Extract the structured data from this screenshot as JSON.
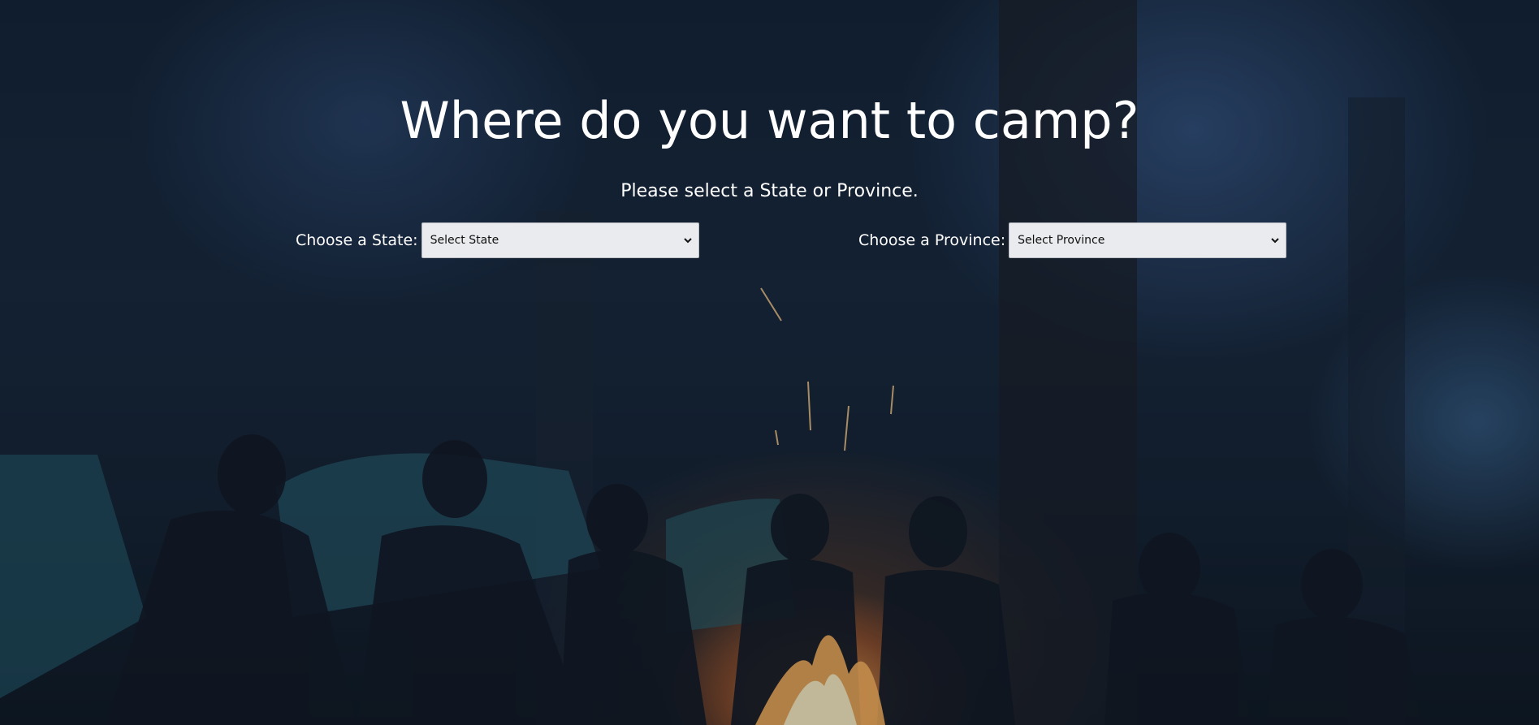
{
  "header": {
    "title": "Where do you want to camp?",
    "subtitle": "Please select a State or Province."
  },
  "state_selector": {
    "label": "Choose a State:",
    "selected": "Select State"
  },
  "province_selector": {
    "label": "Choose a Province:",
    "selected": "Select Province"
  },
  "colors": {
    "text": "#ffffff",
    "select_bg": "#e9ebee"
  }
}
